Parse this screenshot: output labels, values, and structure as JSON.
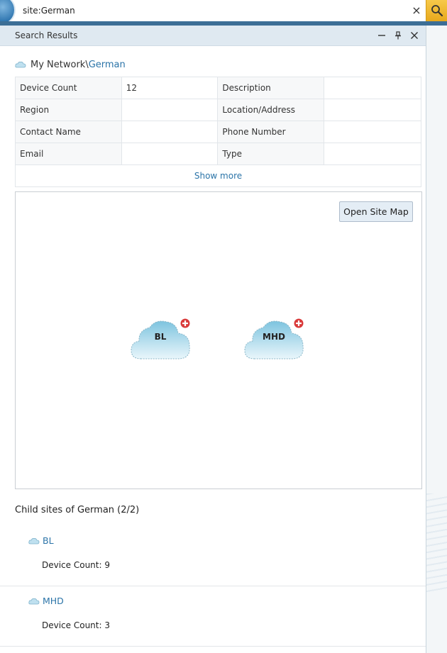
{
  "search": {
    "value": "site:German",
    "clear_label": "×"
  },
  "panel": {
    "title": "Search Results",
    "buttons": [
      "minimize-icon",
      "pin-icon",
      "close-icon"
    ]
  },
  "breadcrumb": {
    "root": "My Network\\",
    "current": "German",
    "icon": "cloud-site-icon"
  },
  "info": {
    "rows": [
      {
        "label1": "Device Count",
        "value1": "12",
        "label2": "Description",
        "value2": ""
      },
      {
        "label1": "Region",
        "value1": "",
        "label2": "Location/Address",
        "value2": ""
      },
      {
        "label1": "Contact Name",
        "value1": "",
        "label2": "Phone Number",
        "value2": ""
      },
      {
        "label1": "Email",
        "value1": "",
        "label2": "Type",
        "value2": ""
      }
    ],
    "show_more": "Show more"
  },
  "map": {
    "open_button": "Open Site Map",
    "nodes": [
      {
        "label": "BL"
      },
      {
        "label": "MHD"
      }
    ]
  },
  "children": {
    "heading": "Child sites of German (2/2)",
    "items": [
      {
        "name": "BL",
        "count": "Device Count: 9"
      },
      {
        "name": "MHD",
        "count": "Device Count: 3"
      }
    ]
  },
  "colors": {
    "link": "#2b74a8",
    "header_bg": "#dfe9f1",
    "search_button": "#e7a81c",
    "accent_band": "#3c6e96",
    "badge_red": "#d93a3a"
  }
}
